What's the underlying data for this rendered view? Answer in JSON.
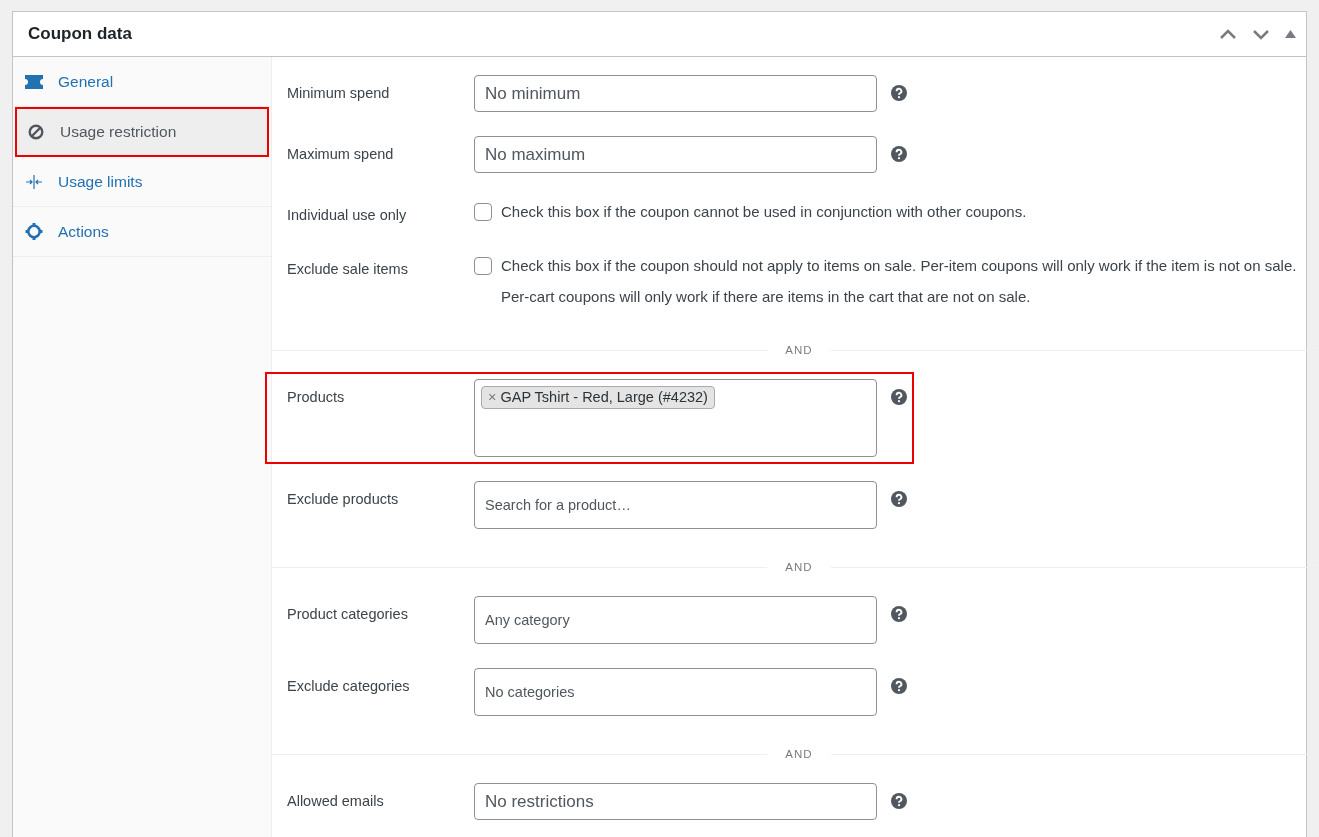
{
  "panel": {
    "title": "Coupon data"
  },
  "tabs": [
    {
      "kind": "ticket",
      "label": "General",
      "selected": false,
      "highlighted": false
    },
    {
      "kind": "blocked",
      "label": "Usage restriction",
      "selected": true,
      "highlighted": true
    },
    {
      "kind": "limits",
      "label": "Usage limits",
      "selected": false,
      "highlighted": false
    },
    {
      "kind": "gear",
      "label": "Actions",
      "selected": false,
      "highlighted": false
    }
  ],
  "sections": [
    {
      "rows": [
        {
          "kind": "text",
          "label": "Minimum spend",
          "placeholder": "No minimum",
          "highlighted": false
        },
        {
          "kind": "text",
          "label": "Maximum spend",
          "placeholder": "No maximum",
          "highlighted": false
        },
        {
          "kind": "checkbox",
          "label": "Individual use only",
          "checked": false,
          "description": "Check this box if the coupon cannot be used in conjunction with other coupons.",
          "highlighted": false
        },
        {
          "kind": "checkbox",
          "label": "Exclude sale items",
          "checked": false,
          "description": "Check this box if the coupon should not apply to items on sale. Per-item coupons will only work if the item is not on sale. Per-cart coupons will only work if there are items in the cart that are not on sale.",
          "highlighted": false
        }
      ]
    },
    {
      "separator": "AND",
      "rows": [
        {
          "kind": "tags",
          "label": "Products",
          "tags": [
            {
              "remove": "×",
              "label": "GAP Tshirt - Red, Large (#4232)"
            }
          ],
          "highlighted": true
        },
        {
          "kind": "select",
          "label": "Exclude products",
          "placeholder": "Search for a product…",
          "highlighted": false
        }
      ]
    },
    {
      "separator": "AND",
      "rows": [
        {
          "kind": "select",
          "label": "Product categories",
          "placeholder": "Any category",
          "highlighted": false
        },
        {
          "kind": "select",
          "label": "Exclude categories",
          "placeholder": "No categories",
          "highlighted": false
        }
      ]
    },
    {
      "separator": "AND",
      "rows": [
        {
          "kind": "text",
          "label": "Allowed emails",
          "placeholder": "No restrictions",
          "highlighted": false
        }
      ]
    }
  ]
}
